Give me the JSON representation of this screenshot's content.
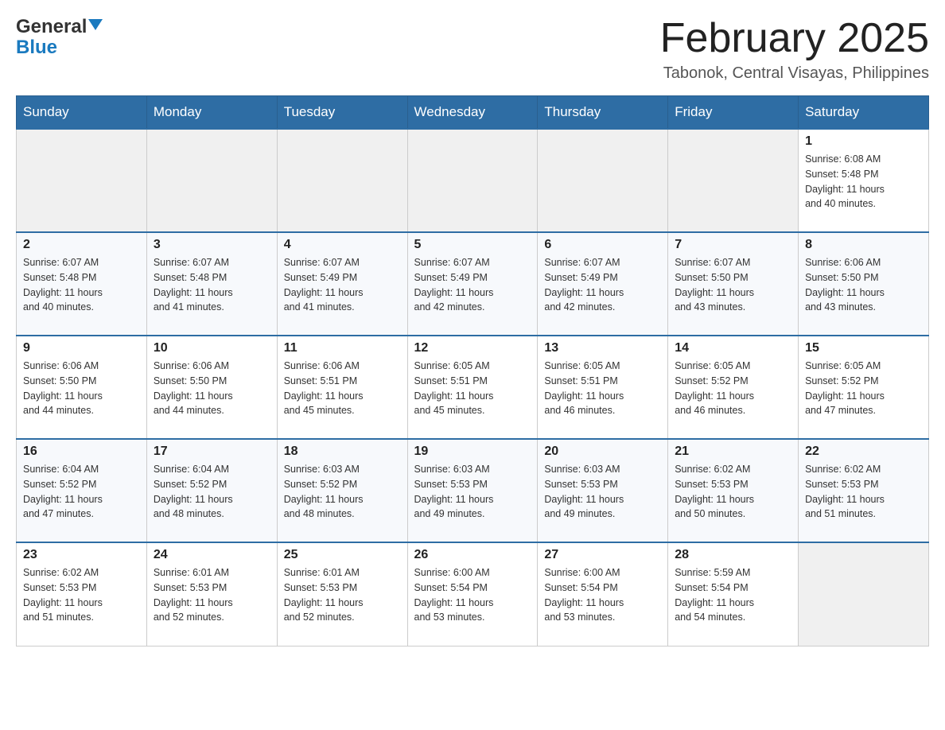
{
  "header": {
    "logo_general": "General",
    "logo_blue": "Blue",
    "month_title": "February 2025",
    "location": "Tabonok, Central Visayas, Philippines"
  },
  "days_of_week": [
    "Sunday",
    "Monday",
    "Tuesday",
    "Wednesday",
    "Thursday",
    "Friday",
    "Saturday"
  ],
  "weeks": [
    [
      {
        "day": "",
        "info": ""
      },
      {
        "day": "",
        "info": ""
      },
      {
        "day": "",
        "info": ""
      },
      {
        "day": "",
        "info": ""
      },
      {
        "day": "",
        "info": ""
      },
      {
        "day": "",
        "info": ""
      },
      {
        "day": "1",
        "info": "Sunrise: 6:08 AM\nSunset: 5:48 PM\nDaylight: 11 hours\nand 40 minutes."
      }
    ],
    [
      {
        "day": "2",
        "info": "Sunrise: 6:07 AM\nSunset: 5:48 PM\nDaylight: 11 hours\nand 40 minutes."
      },
      {
        "day": "3",
        "info": "Sunrise: 6:07 AM\nSunset: 5:48 PM\nDaylight: 11 hours\nand 41 minutes."
      },
      {
        "day": "4",
        "info": "Sunrise: 6:07 AM\nSunset: 5:49 PM\nDaylight: 11 hours\nand 41 minutes."
      },
      {
        "day": "5",
        "info": "Sunrise: 6:07 AM\nSunset: 5:49 PM\nDaylight: 11 hours\nand 42 minutes."
      },
      {
        "day": "6",
        "info": "Sunrise: 6:07 AM\nSunset: 5:49 PM\nDaylight: 11 hours\nand 42 minutes."
      },
      {
        "day": "7",
        "info": "Sunrise: 6:07 AM\nSunset: 5:50 PM\nDaylight: 11 hours\nand 43 minutes."
      },
      {
        "day": "8",
        "info": "Sunrise: 6:06 AM\nSunset: 5:50 PM\nDaylight: 11 hours\nand 43 minutes."
      }
    ],
    [
      {
        "day": "9",
        "info": "Sunrise: 6:06 AM\nSunset: 5:50 PM\nDaylight: 11 hours\nand 44 minutes."
      },
      {
        "day": "10",
        "info": "Sunrise: 6:06 AM\nSunset: 5:50 PM\nDaylight: 11 hours\nand 44 minutes."
      },
      {
        "day": "11",
        "info": "Sunrise: 6:06 AM\nSunset: 5:51 PM\nDaylight: 11 hours\nand 45 minutes."
      },
      {
        "day": "12",
        "info": "Sunrise: 6:05 AM\nSunset: 5:51 PM\nDaylight: 11 hours\nand 45 minutes."
      },
      {
        "day": "13",
        "info": "Sunrise: 6:05 AM\nSunset: 5:51 PM\nDaylight: 11 hours\nand 46 minutes."
      },
      {
        "day": "14",
        "info": "Sunrise: 6:05 AM\nSunset: 5:52 PM\nDaylight: 11 hours\nand 46 minutes."
      },
      {
        "day": "15",
        "info": "Sunrise: 6:05 AM\nSunset: 5:52 PM\nDaylight: 11 hours\nand 47 minutes."
      }
    ],
    [
      {
        "day": "16",
        "info": "Sunrise: 6:04 AM\nSunset: 5:52 PM\nDaylight: 11 hours\nand 47 minutes."
      },
      {
        "day": "17",
        "info": "Sunrise: 6:04 AM\nSunset: 5:52 PM\nDaylight: 11 hours\nand 48 minutes."
      },
      {
        "day": "18",
        "info": "Sunrise: 6:03 AM\nSunset: 5:52 PM\nDaylight: 11 hours\nand 48 minutes."
      },
      {
        "day": "19",
        "info": "Sunrise: 6:03 AM\nSunset: 5:53 PM\nDaylight: 11 hours\nand 49 minutes."
      },
      {
        "day": "20",
        "info": "Sunrise: 6:03 AM\nSunset: 5:53 PM\nDaylight: 11 hours\nand 49 minutes."
      },
      {
        "day": "21",
        "info": "Sunrise: 6:02 AM\nSunset: 5:53 PM\nDaylight: 11 hours\nand 50 minutes."
      },
      {
        "day": "22",
        "info": "Sunrise: 6:02 AM\nSunset: 5:53 PM\nDaylight: 11 hours\nand 51 minutes."
      }
    ],
    [
      {
        "day": "23",
        "info": "Sunrise: 6:02 AM\nSunset: 5:53 PM\nDaylight: 11 hours\nand 51 minutes."
      },
      {
        "day": "24",
        "info": "Sunrise: 6:01 AM\nSunset: 5:53 PM\nDaylight: 11 hours\nand 52 minutes."
      },
      {
        "day": "25",
        "info": "Sunrise: 6:01 AM\nSunset: 5:53 PM\nDaylight: 11 hours\nand 52 minutes."
      },
      {
        "day": "26",
        "info": "Sunrise: 6:00 AM\nSunset: 5:54 PM\nDaylight: 11 hours\nand 53 minutes."
      },
      {
        "day": "27",
        "info": "Sunrise: 6:00 AM\nSunset: 5:54 PM\nDaylight: 11 hours\nand 53 minutes."
      },
      {
        "day": "28",
        "info": "Sunrise: 5:59 AM\nSunset: 5:54 PM\nDaylight: 11 hours\nand 54 minutes."
      },
      {
        "day": "",
        "info": ""
      }
    ]
  ]
}
